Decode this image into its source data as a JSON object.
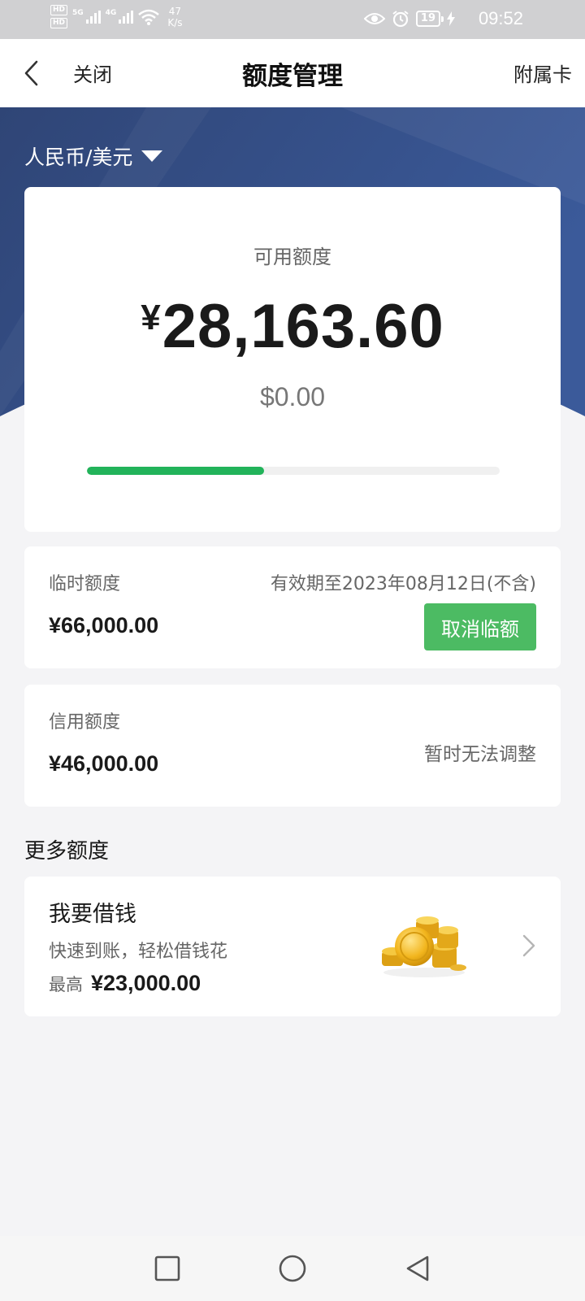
{
  "status_bar": {
    "hd1": "HD",
    "hd2": "HD",
    "net1": "5G",
    "net2": "4G",
    "speed_value": "47",
    "speed_unit": "K/s",
    "battery": "19",
    "time": "09:52"
  },
  "nav": {
    "close_label": "关闭",
    "title": "额度管理",
    "secondary_card_label": "附属卡"
  },
  "hero": {
    "currency_selector": "人民币/美元",
    "gradient_start": "#2f4576",
    "gradient_end": "#3b5a9a"
  },
  "available": {
    "label": "可用额度",
    "cny_symbol": "¥",
    "cny_amount": "28,163.60",
    "usd_amount": "$0.00",
    "used_fraction": 0.43,
    "progress_color": "#22b35a"
  },
  "temporary": {
    "label": "临时额度",
    "value": "¥66,000.00",
    "validity": "有效期至2023年08月12日(不含)",
    "cancel_label": "取消临额",
    "button_color": "#4cbb63"
  },
  "credit": {
    "label": "信用额度",
    "value": "¥46,000.00",
    "note": "暂时无法调整"
  },
  "more": {
    "title": "更多额度",
    "loan": {
      "title": "我要借钱",
      "subtitle": "快速到账，轻松借钱花",
      "max_label": "最高",
      "max_value": "¥23,000.00",
      "icon": "gold-coins-icon"
    }
  },
  "system_nav": {
    "recents_icon": "square-icon",
    "home_icon": "circle-icon",
    "back_icon": "triangle-back-icon"
  }
}
